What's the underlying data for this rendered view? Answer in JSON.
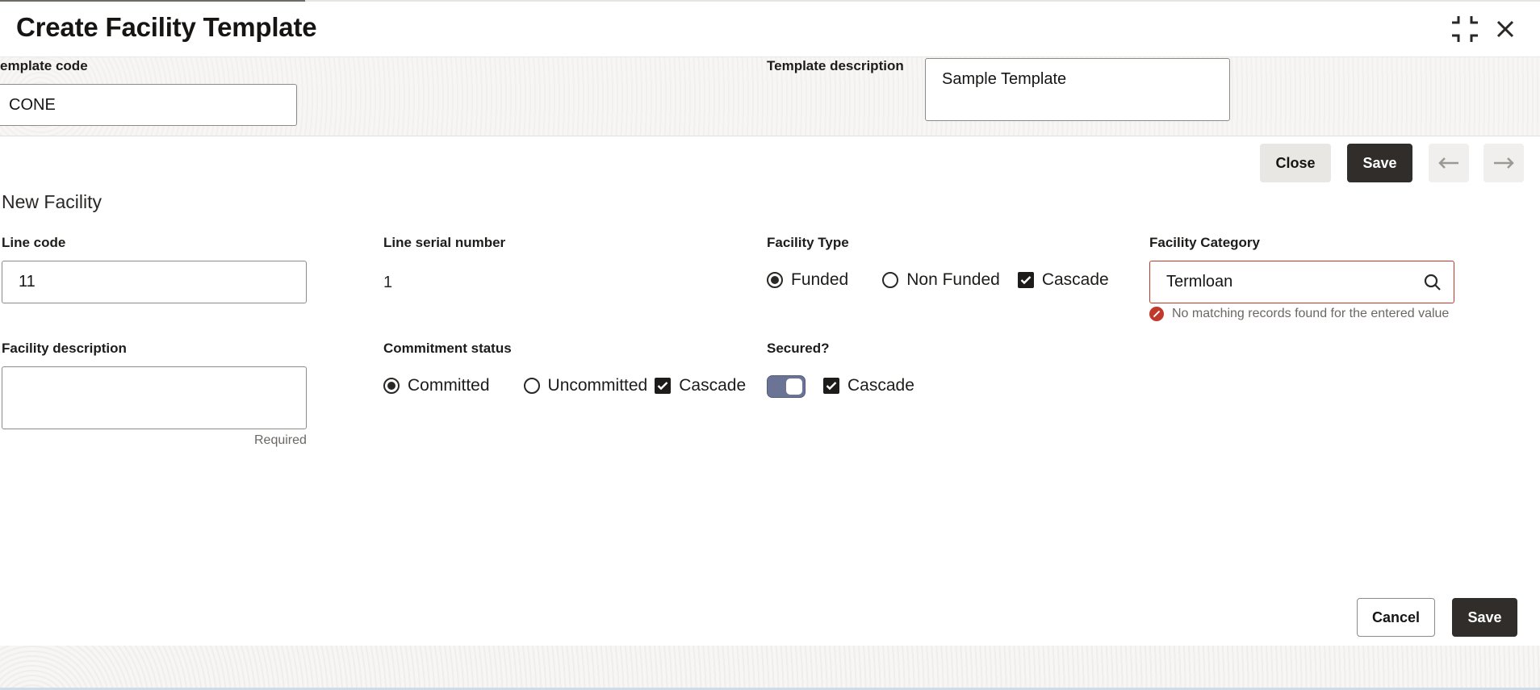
{
  "dialog": {
    "title": "Create Facility Template",
    "collapse_icon": "collapse-icon",
    "close_icon": "close-icon"
  },
  "header": {
    "template_code_label": "emplate code",
    "template_code_value": "CONE",
    "template_description_label": "Template description",
    "template_description_value": "Sample Template"
  },
  "toolbar": {
    "close_label": "Close",
    "save_label": "Save",
    "prev_icon": "arrow-left-icon",
    "next_icon": "arrow-right-icon"
  },
  "section": {
    "title": "New Facility"
  },
  "fields": {
    "line_code_label": "Line code",
    "line_code_value": "11",
    "line_serial_label": "Line serial number",
    "line_serial_value": "1",
    "facility_type_label": "Facility Type",
    "facility_type_options": [
      "Funded",
      "Non Funded"
    ],
    "facility_type_selected": "Funded",
    "facility_type_cascade": "Cascade",
    "facility_category_label": "Facility Category",
    "facility_category_value": "Termloan",
    "facility_category_error": "No matching records found for the entered value",
    "facility_description_label": "Facility description",
    "facility_description_value": "",
    "facility_description_helper": "Required",
    "commitment_status_label": "Commitment status",
    "commitment_options": [
      "Committed",
      "Uncommitted"
    ],
    "commitment_selected": "Committed",
    "commitment_cascade": "Cascade",
    "secured_label": "Secured?",
    "secured_on": true,
    "secured_cascade": "Cascade"
  },
  "footer": {
    "cancel_label": "Cancel",
    "save_label": "Save"
  },
  "colors": {
    "primary_button": "#312d2a",
    "error": "#c0392b",
    "toggle_on": "#6b7494"
  }
}
